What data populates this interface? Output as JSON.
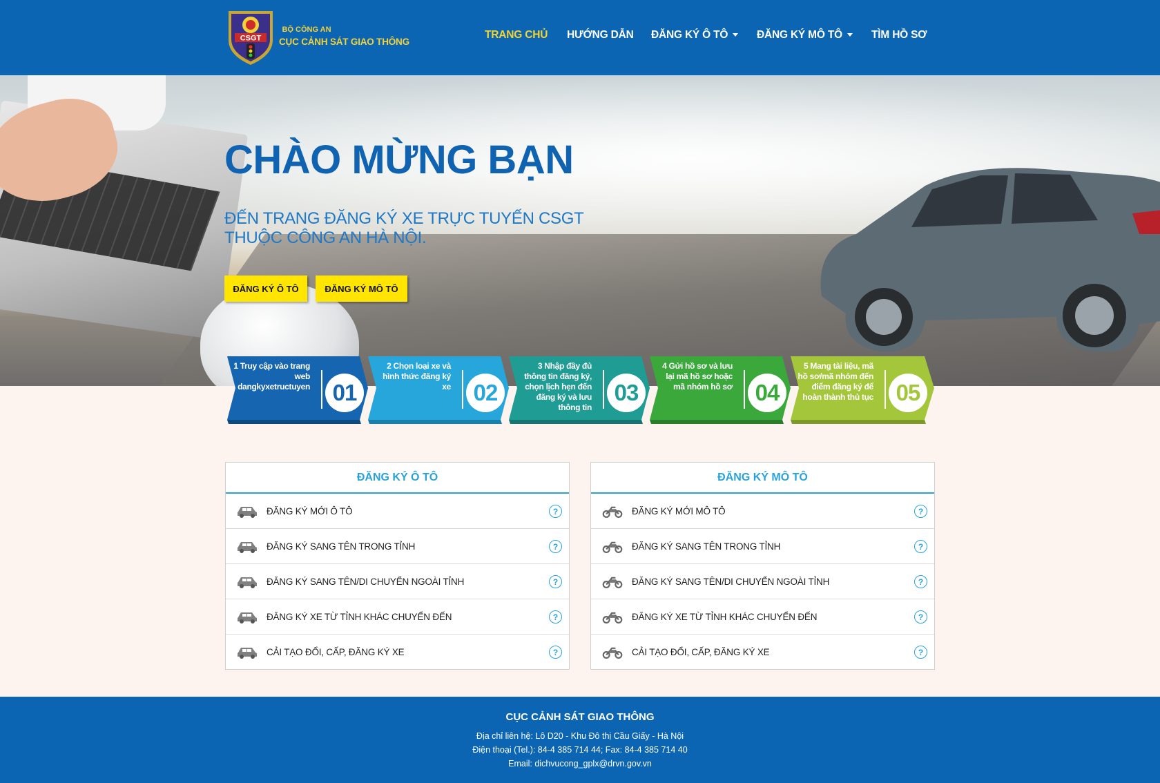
{
  "header": {
    "logo_badge": "CSGT",
    "org_line1": "BỘ CÔNG AN",
    "org_line2": "CỤC CẢNH SÁT GIAO THÔNG",
    "nav": [
      {
        "label": "TRANG CHỦ",
        "active": true,
        "dropdown": false
      },
      {
        "label": "HƯỚNG DẪN",
        "active": false,
        "dropdown": false
      },
      {
        "label": "ĐĂNG KÝ Ô TÔ",
        "active": false,
        "dropdown": true
      },
      {
        "label": "ĐĂNG KÝ MÔ TÔ",
        "active": false,
        "dropdown": true
      },
      {
        "label": "TÌM HỒ SƠ",
        "active": false,
        "dropdown": false
      }
    ]
  },
  "hero": {
    "title": "CHÀO MỪNG BẠN",
    "subtitle_line1": "ĐẾN TRANG ĐĂNG KÝ XE TRỰC TUYẾN CSGT",
    "subtitle_line2": "THUỘC CÔNG AN HÀ NỘI.",
    "btn_car": "ĐĂNG KÝ Ô TÔ",
    "btn_moto": "ĐĂNG KÝ MÔ TÔ"
  },
  "steps": [
    {
      "text": "1 Truy cập vào trang web dangkyxetructuyen",
      "num": "01",
      "color": "#1565b0"
    },
    {
      "text": "2 Chọn loại xe và hình thức đăng ký xe",
      "num": "02",
      "color": "#27a6dc"
    },
    {
      "text": "3 Nhập đầy đủ thông tin đăng ký, chọn lịch hẹn đến đăng ký và lưu thông tin",
      "num": "03",
      "color": "#1f9d95"
    },
    {
      "text": "4 Gửi hồ sơ và lưu lại mã hồ sơ hoặc mã nhóm hồ sơ",
      "num": "04",
      "color": "#3aa83b"
    },
    {
      "text": "5 Mang tài liệu, mã hồ sơ/mã nhóm đến điểm đăng ký để hoàn thành thủ tục",
      "num": "05",
      "color": "#a4c63a"
    }
  ],
  "panels": {
    "car": {
      "title": "ĐĂNG KÝ Ô TÔ",
      "items": [
        "ĐĂNG KÝ MỚI Ô TÔ",
        "ĐĂNG KÝ SANG TÊN TRONG TỈNH",
        "ĐĂNG KÝ SANG TÊN/DI CHUYỂN NGOÀI TỈNH",
        "ĐĂNG KÝ XE TỪ TỈNH KHÁC CHUYỂN ĐẾN",
        "CẢI TẠO ĐỔI, CẤP, ĐĂNG KÝ XE"
      ]
    },
    "moto": {
      "title": "ĐĂNG KÝ MÔ TÔ",
      "items": [
        "ĐĂNG KÝ MỚI MÔ TÔ",
        "ĐĂNG KÝ SANG TÊN TRONG TỈNH",
        "ĐĂNG KÝ SANG TÊN/DI CHUYỂN NGOÀI TỈNH",
        "ĐĂNG KÝ XE TỪ TỈNH KHÁC CHUYỂN ĐẾN",
        "CẢI TẠO ĐỔI, CẤP, ĐĂNG KÝ XE"
      ]
    },
    "help_glyph": "?"
  },
  "footer": {
    "title": "CỤC CẢNH SÁT GIAO THÔNG",
    "address": "Địa chỉ liên hệ: Lô D20 - Khu Đô thị Cầu Giấy - Hà Nội",
    "phone": "Điện thoại (Tel.): 84-4 385 714 44; Fax: 84-4 385 714 40",
    "email": "Email: dichvucong_gplx@drvn.gov.vn"
  }
}
